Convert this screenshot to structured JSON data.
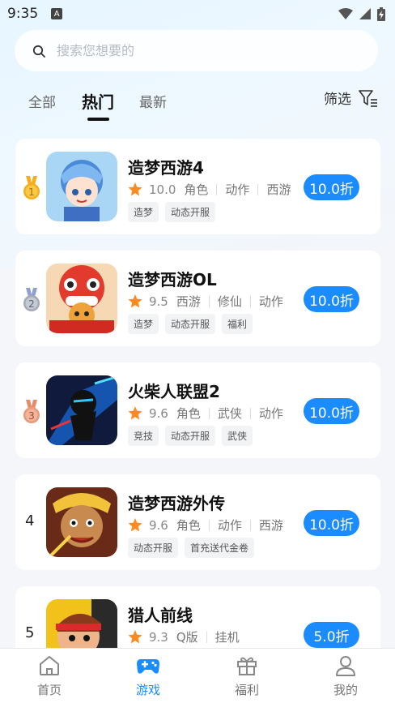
{
  "status_bar": {
    "time": "9:35",
    "notification_icon": "A"
  },
  "search": {
    "placeholder": "搜索您想要的"
  },
  "tabs": [
    {
      "label": "全部"
    },
    {
      "label": "热门"
    },
    {
      "label": "最新"
    }
  ],
  "active_tab": "热门",
  "filter": {
    "label": "筛选"
  },
  "games": [
    {
      "rank": "1",
      "rank_style": "gold",
      "title": "造梦西游4",
      "score": "10.0",
      "categories": [
        "角色",
        "动作",
        "西游"
      ],
      "tags": [
        "造梦",
        "动态开服"
      ],
      "discount": "10.0折"
    },
    {
      "rank": "2",
      "rank_style": "silver",
      "title": "造梦西游OL",
      "score": "9.5",
      "categories": [
        "西游",
        "修仙",
        "动作"
      ],
      "tags": [
        "造梦",
        "动态开服",
        "福利"
      ],
      "discount": "10.0折"
    },
    {
      "rank": "3",
      "rank_style": "bronze",
      "title": "火柴人联盟2",
      "score": "9.6",
      "categories": [
        "角色",
        "武侠",
        "动作"
      ],
      "tags": [
        "竞技",
        "动态开服",
        "武侠"
      ],
      "discount": "10.0折"
    },
    {
      "rank": "4",
      "rank_style": "plain",
      "title": "造梦西游外传",
      "score": "9.6",
      "categories": [
        "角色",
        "动作",
        "西游"
      ],
      "tags": [
        "动态开服",
        "首充送代金卷"
      ],
      "discount": "10.0折"
    },
    {
      "rank": "5",
      "rank_style": "plain",
      "title": "猎人前线",
      "score": "9.3",
      "categories": [
        "Q版",
        "挂机"
      ],
      "tags": [],
      "discount": "5.0折"
    }
  ],
  "bottom_nav": [
    {
      "label": "首页",
      "icon": "home-icon"
    },
    {
      "label": "游戏",
      "icon": "gamepad-icon"
    },
    {
      "label": "福利",
      "icon": "gift-icon"
    },
    {
      "label": "我的",
      "icon": "user-icon"
    }
  ],
  "colors": {
    "accent": "#1a8cff",
    "star": "#ff8a1f",
    "gold": "#f2b01e",
    "silver": "#a3aab6",
    "bronze": "#e79a7c"
  }
}
